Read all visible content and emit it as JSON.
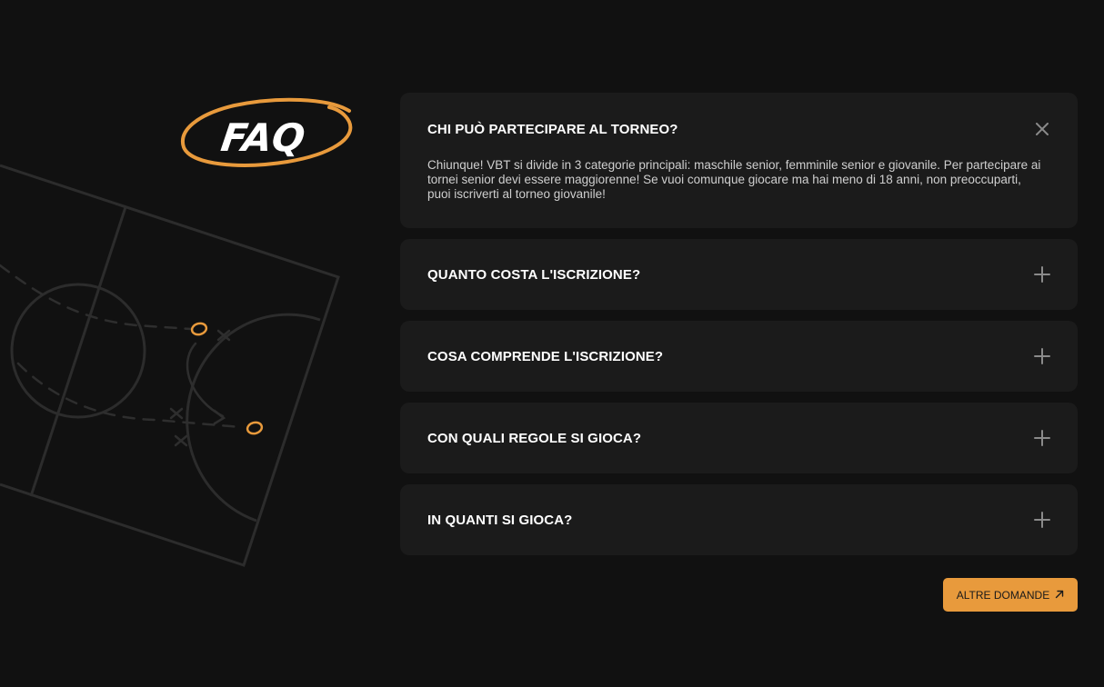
{
  "colors": {
    "background": "#111111",
    "card": "#1b1b1b",
    "accent": "#e89a3c",
    "question_text": "#ffffff",
    "answer_text": "#cfcfcf"
  },
  "logo": {
    "text": "FAQ"
  },
  "faq": [
    {
      "question": "CHI PUÒ PARTECIPARE AL TORNEO?",
      "answer": "Chiunque! VBT si divide in 3 categorie principali: maschile senior, femminile senior e giovanile. Per partecipare ai tornei senior devi essere maggiorenne! Se vuoi comunque giocare ma hai meno di 18 anni, non preoccuparti, puoi iscriverti al torneo giovanile!",
      "expanded": true,
      "icon": "close-icon"
    },
    {
      "question": "QUANTO COSTA L'ISCRIZIONE?",
      "expanded": false,
      "icon": "plus-icon"
    },
    {
      "question": "COSA COMPRENDE L'ISCRIZIONE?",
      "expanded": false,
      "icon": "plus-icon"
    },
    {
      "question": "CON QUALI REGOLE SI GIOCA?",
      "expanded": false,
      "icon": "plus-icon"
    },
    {
      "question": "IN QUANTI SI GIOCA?",
      "expanded": false,
      "icon": "plus-icon"
    }
  ],
  "more_button": {
    "label": "ALTRE DOMANDE",
    "icon": "arrow-up-right-icon"
  }
}
